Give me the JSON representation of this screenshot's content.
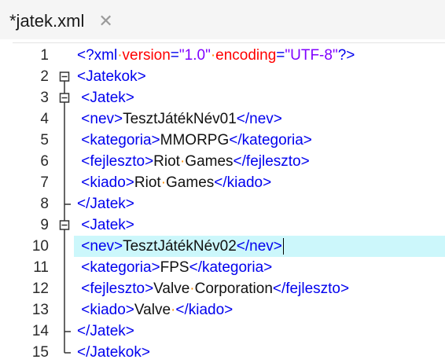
{
  "tab": {
    "title": "*jatek.xml",
    "close_glyph": "✕"
  },
  "lines": [
    {
      "num": "1",
      "fold": "none",
      "segments": [
        {
          "t": "<?xml",
          "c": "tag"
        },
        {
          "t": "·",
          "c": "dot"
        },
        {
          "t": "version",
          "c": "attr"
        },
        {
          "t": "=",
          "c": "tag"
        },
        {
          "t": "\"1.0\"",
          "c": "val"
        },
        {
          "t": "·",
          "c": "dot"
        },
        {
          "t": "encoding",
          "c": "attr"
        },
        {
          "t": "=",
          "c": "tag"
        },
        {
          "t": "\"UTF-8\"",
          "c": "val"
        },
        {
          "t": "?>",
          "c": "tag"
        }
      ]
    },
    {
      "num": "2",
      "fold": "box-start",
      "segments": [
        {
          "t": "<Jatekok>",
          "c": "tag"
        }
      ]
    },
    {
      "num": "3",
      "fold": "box-mid",
      "segments": [
        {
          "t": " <Jatek>",
          "c": "tag"
        }
      ]
    },
    {
      "num": "4",
      "fold": "line",
      "segments": [
        {
          "t": " <nev>",
          "c": "tag"
        },
        {
          "t": "TesztJátékNév01",
          "c": "txt"
        },
        {
          "t": "</nev>",
          "c": "tag"
        }
      ]
    },
    {
      "num": "5",
      "fold": "line",
      "segments": [
        {
          "t": " <kategoria>",
          "c": "tag"
        },
        {
          "t": "MMORPG",
          "c": "txt"
        },
        {
          "t": "</kategoria>",
          "c": "tag"
        }
      ]
    },
    {
      "num": "6",
      "fold": "line",
      "segments": [
        {
          "t": " <fejleszto>",
          "c": "tag"
        },
        {
          "t": "Riot",
          "c": "txt"
        },
        {
          "t": "·",
          "c": "dot"
        },
        {
          "t": "Games",
          "c": "txt"
        },
        {
          "t": "</fejleszto>",
          "c": "tag"
        }
      ]
    },
    {
      "num": "7",
      "fold": "line",
      "segments": [
        {
          "t": " <kiado>",
          "c": "tag"
        },
        {
          "t": "Riot",
          "c": "txt"
        },
        {
          "t": "·",
          "c": "dot"
        },
        {
          "t": "Games",
          "c": "txt"
        },
        {
          "t": "</kiado>",
          "c": "tag"
        }
      ]
    },
    {
      "num": "8",
      "fold": "end-mid",
      "segments": [
        {
          "t": "</Jatek>",
          "c": "tag"
        }
      ]
    },
    {
      "num": "9",
      "fold": "box-mid",
      "segments": [
        {
          "t": " <Jatek>",
          "c": "tag"
        }
      ]
    },
    {
      "num": "10",
      "fold": "line",
      "active": true,
      "segments": [
        {
          "t": " <nev>",
          "c": "tag"
        },
        {
          "t": "TesztJátékNév02",
          "c": "txt"
        },
        {
          "t": "</nev>",
          "c": "tag"
        }
      ]
    },
    {
      "num": "11",
      "fold": "line",
      "segments": [
        {
          "t": " <kategoria>",
          "c": "tag"
        },
        {
          "t": "FPS",
          "c": "txt"
        },
        {
          "t": "</kategoria>",
          "c": "tag"
        }
      ]
    },
    {
      "num": "12",
      "fold": "line",
      "segments": [
        {
          "t": " <fejleszto>",
          "c": "tag"
        },
        {
          "t": "Valve",
          "c": "txt"
        },
        {
          "t": "·",
          "c": "dot"
        },
        {
          "t": "Corporation",
          "c": "txt"
        },
        {
          "t": "</fejleszto>",
          "c": "tag"
        }
      ]
    },
    {
      "num": "13",
      "fold": "line",
      "segments": [
        {
          "t": " <kiado>",
          "c": "tag"
        },
        {
          "t": "Valve",
          "c": "txt"
        },
        {
          "t": "·",
          "c": "dot"
        },
        {
          "t": "</kiado>",
          "c": "tag"
        }
      ]
    },
    {
      "num": "14",
      "fold": "end-mid",
      "segments": [
        {
          "t": "</Jatek>",
          "c": "tag"
        }
      ]
    },
    {
      "num": "15",
      "fold": "end-last",
      "segments": [
        {
          "t": "</Jatekok>",
          "c": "tag"
        }
      ]
    }
  ],
  "colors": {
    "tag": "#0000ee",
    "attr": "#ff0000",
    "value": "#8000ff",
    "text": "#111111",
    "whitespace_dot": "#ff8c00",
    "active_line": "#ccf7fb"
  }
}
